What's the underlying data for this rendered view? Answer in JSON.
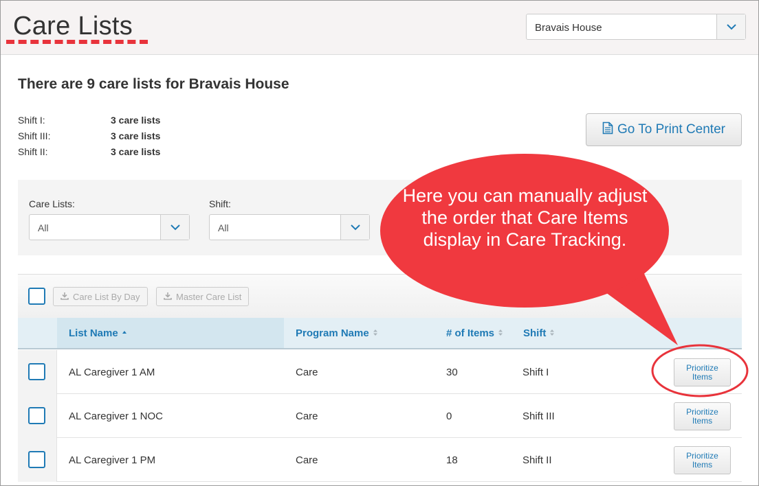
{
  "header": {
    "title": "Care Lists",
    "facility_select": {
      "value": "Bravais House"
    }
  },
  "summary": {
    "title": "There are 9 care lists for Bravais House",
    "shifts": [
      {
        "label": "Shift I:",
        "count": "3 care lists"
      },
      {
        "label": "Shift III:",
        "count": "3 care lists"
      },
      {
        "label": "Shift II:",
        "count": "3 care lists"
      }
    ]
  },
  "print_center": {
    "label": "Go To Print Center",
    "icon": "document-icon"
  },
  "filters": {
    "care_lists": {
      "label": "Care Lists:",
      "value": "All"
    },
    "shift": {
      "label": "Shift:",
      "value": "All"
    }
  },
  "toolbar": {
    "care_list_by_day": "Care List By Day",
    "master_care_list": "Master Care List"
  },
  "table": {
    "columns": [
      "List Name",
      "Program Name",
      "# of Items",
      "Shift"
    ],
    "rows": [
      {
        "list_name": "AL Caregiver 1 AM",
        "program": "Care",
        "items": "30",
        "shift": "Shift I",
        "action_line1": "Prioritize",
        "action_line2": "Items"
      },
      {
        "list_name": "AL Caregiver 1 NOC",
        "program": "Care",
        "items": "0",
        "shift": "Shift III",
        "action_line1": "Prioritize",
        "action_line2": "Items"
      },
      {
        "list_name": "AL Caregiver 1 PM",
        "program": "Care",
        "items": "18",
        "shift": "Shift II",
        "action_line1": "Prioritize",
        "action_line2": "Items"
      }
    ]
  },
  "annotation": {
    "text": "Here you can manually adjust the order that Care Items display in Care Tracking.",
    "color": "#f0393f",
    "highlight_color": "#e8333b"
  },
  "colors": {
    "link_blue": "#1f7ab5",
    "header_bg": "#f6f3f3",
    "table_header_bg": "#e3eff5"
  }
}
